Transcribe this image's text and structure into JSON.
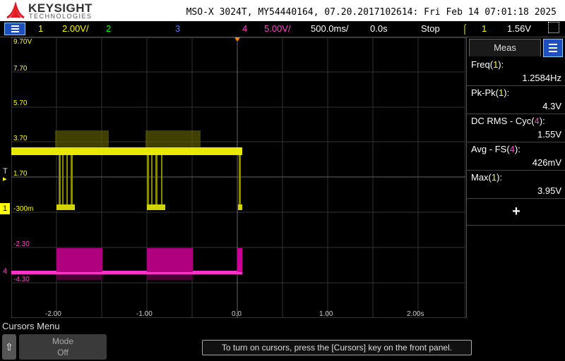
{
  "header": {
    "brand": "KEYSIGHT",
    "brand_sub": "TECHNOLOGIES",
    "info": "MSO-X 3024T, MY54440164, 07.20.2017102614: Fri Feb 14 07:01:18 2025"
  },
  "channel_bar": {
    "ch1_num": "1",
    "ch1_scale": "2.00V/",
    "ch2_num": "2",
    "ch3_num": "3",
    "ch4_num": "4",
    "ch4_scale": "5.00V/",
    "timebase": "500.0ms/",
    "delay": "0.0s",
    "run_state": "Stop",
    "trigger_source": "1",
    "trigger_level": "1.56V",
    "colors": {
      "ch1": "#ffff00",
      "ch2": "#00ff00",
      "ch3": "#4d7dff",
      "ch4": "#ff44cc",
      "accent": "#1d4fbf"
    }
  },
  "graticule": {
    "y_labels_ch1": [
      "9.70V",
      "7.70",
      "5.70",
      "3.70",
      "1.70",
      "-300m"
    ],
    "y_labels_ch4": [
      "-2.30",
      "-4.30"
    ],
    "x_labels": [
      "-2.00",
      "-1.00",
      "0.0",
      "1.00",
      "2.00s"
    ],
    "ch1_marker": "1",
    "ch4_marker": "4",
    "trigger_marker": "T"
  },
  "measurements": {
    "tab_label": "Meas",
    "items": [
      {
        "label_pre": "Freq(",
        "src": "1",
        "label_post": "):",
        "value": "1.2584Hz"
      },
      {
        "label_pre": "Pk-Pk(",
        "src": "1",
        "label_post": "):",
        "value": "4.3V"
      },
      {
        "label_pre": "DC RMS - Cyc(",
        "src": "4",
        "label_post": "):",
        "value": "1.55V"
      },
      {
        "label_pre": "Avg - FS(",
        "src": "4",
        "label_post": "):",
        "value": "426mV"
      },
      {
        "label_pre": "Max(",
        "src": "1",
        "label_post": "):",
        "value": "3.95V"
      }
    ],
    "add_label": "+"
  },
  "footer": {
    "menu_title": "Cursors Menu",
    "mode_label": "Mode",
    "mode_value": "Off",
    "message": "To turn on cursors, press the [Cursors] key on the front panel."
  }
}
